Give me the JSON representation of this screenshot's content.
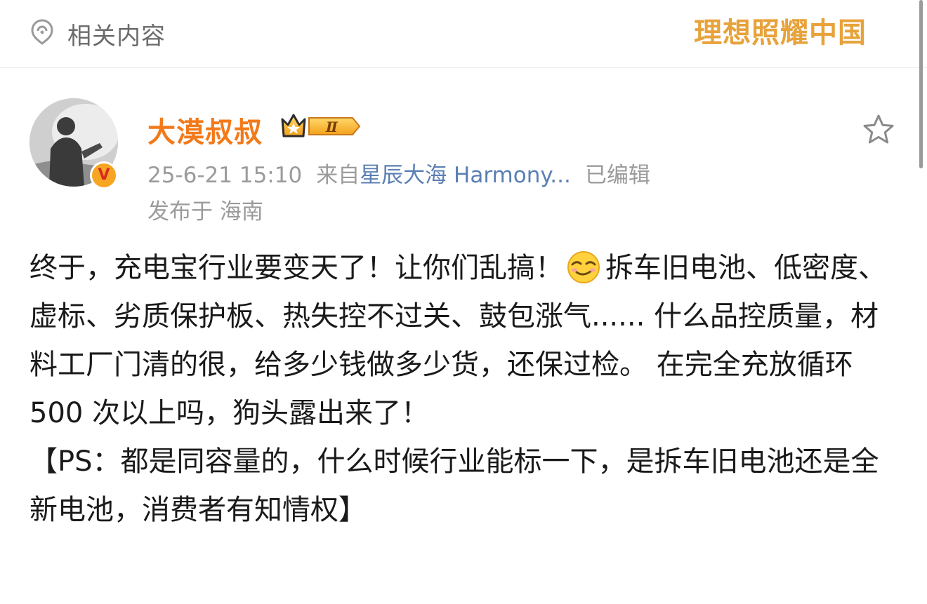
{
  "section": {
    "title": "相关内容",
    "slogan": "理想照耀中国"
  },
  "post": {
    "author": "大漠叔叔",
    "level_badge": "Ⅱ",
    "verified_mark": "V",
    "timestamp": "25-6-21 15:10",
    "source_prefix": "来自",
    "source_name": "星辰大海 Harmony...",
    "edited": "已编辑",
    "location": "发布于 海南",
    "body_part1": "终于，充电宝行业要变天了！让你们乱搞！",
    "emoji": "smirk-face-emoji",
    "body_part2": "拆车旧电池、低密度、虚标、劣质保护板、热失控不过关、鼓包涨气...... 什么品控质量，材料工厂门清的很，给多少钱做多少货，还保过检。 在完全充放循环 500 次以上吗，狗头露出来了！",
    "ps": "【PS：都是同容量的，什么时候行业能标一下，是拆车旧电池还是全新电池，消费者有知情权】"
  },
  "icons": {
    "section": "ear-icon",
    "favorite": "star-outline-icon",
    "badge": "crown-icon"
  },
  "colors": {
    "author": "#f27a1a",
    "source_link": "#5b7fb4",
    "slogan": "#e7a23a",
    "meta": "#9b9b9b"
  }
}
